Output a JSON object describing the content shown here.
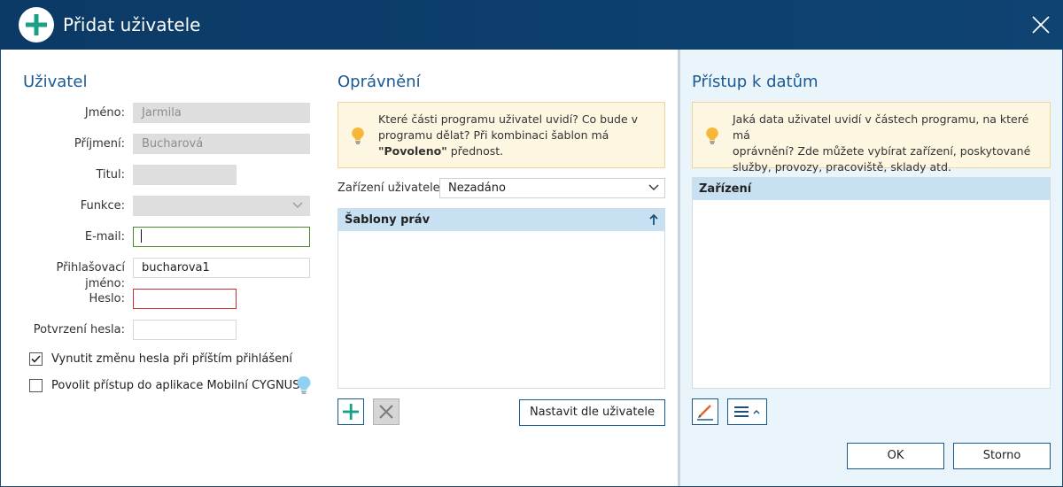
{
  "window": {
    "title": "Přidat uživatele"
  },
  "user_section": {
    "title": "Uživatel",
    "labels": {
      "first_name": "Jméno:",
      "last_name": "Příjmení:",
      "title": "Titul:",
      "function": "Funkce:",
      "email": "E-mail:",
      "login": "Přihlašovací jméno:",
      "password": "Heslo:",
      "password_confirm": "Potvrzení hesla:"
    },
    "values": {
      "first_name": "Jarmila",
      "last_name": "Bucharová",
      "title": "",
      "function": "",
      "email": "",
      "login": "bucharova1",
      "password": "",
      "password_confirm": ""
    },
    "checkboxes": [
      {
        "label": "Vynutit změnu hesla při příštím přihlášení",
        "checked": true
      },
      {
        "label": "Povolit přístup do aplikace Mobilní CYGNUS",
        "checked": false
      }
    ]
  },
  "permissions_section": {
    "title": "Oprávnění",
    "hint_line1": "Které části programu uživatel uvidí? Co bude v",
    "hint_line2": "programu dělat? Při kombinaci šablon má",
    "hint_bold": "\"Povoleno\"",
    "hint_tail": " přednost.",
    "device_label": "Zařízení uživatele:",
    "device_value": "Nezadáno",
    "grid_header": "Šablony práv",
    "set_by_user_button": "Nastavit dle uživatele"
  },
  "data_access_section": {
    "title": "Přístup k datům",
    "hint_line1": "Jaká data uživatel uvidí v částech programu, na které má",
    "hint_line2": "oprávnění? Zde můžete vybírat zařízení, poskytované",
    "hint_line3": "služby, provozy, pracoviště, sklady atd.",
    "grid_header": "Zařízení"
  },
  "footer": {
    "ok_label": "OK",
    "cancel_label": "Storno"
  },
  "colors": {
    "titlebar": "#0f4372",
    "accent": "#1a5a93",
    "green_plus": "#1aa086",
    "hint_bg": "#fdf7e2",
    "grid_header": "#c8e1f2",
    "error": "#cc2d2d",
    "focus": "#4a8a2e"
  }
}
